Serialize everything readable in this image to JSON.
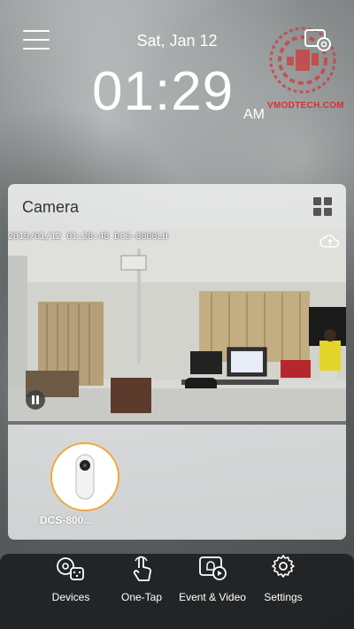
{
  "header": {
    "date": "Sat, Jan 12",
    "time": "01:29",
    "ampm": "AM",
    "watermark": "VMODTECH.COM"
  },
  "camera_card": {
    "title": "Camera",
    "feed_timestamp": "2019/01/12 01:28:48 DCS-8000LH",
    "device": {
      "name": "DCS-800...",
      "status_color": "#f0a93b"
    }
  },
  "tabbar": {
    "items": [
      {
        "label": "Devices",
        "icon": "devices-icon"
      },
      {
        "label": "One-Tap",
        "icon": "one-tap-icon"
      },
      {
        "label": "Event & Video",
        "icon": "event-video-icon"
      },
      {
        "label": "Settings",
        "icon": "settings-icon"
      }
    ]
  },
  "colors": {
    "accent": "#f0a93b",
    "tabbar_bg": "#1e2123",
    "card_bg": "#ebecec"
  }
}
